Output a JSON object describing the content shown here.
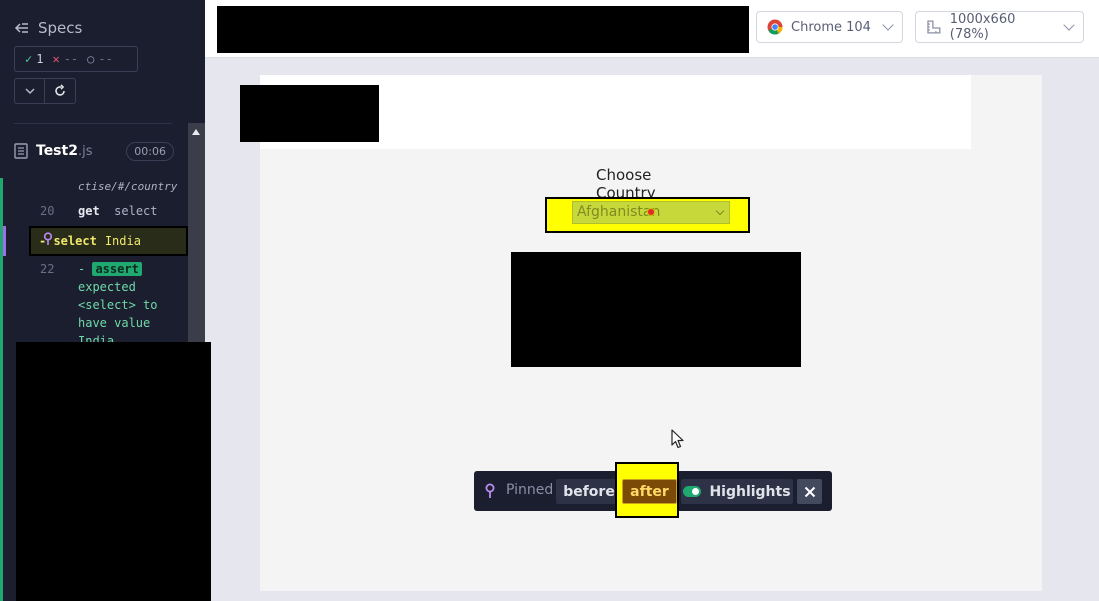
{
  "reporter": {
    "specs_label": "Specs",
    "stats": {
      "passed": "1",
      "failed": "--",
      "pending": "--"
    },
    "file": {
      "name": "Test2",
      "ext": ".js",
      "duration": "00:06"
    },
    "url_fragment": "ctise/#/country",
    "commands": [
      {
        "num": "20",
        "name": "get",
        "arg": "select"
      },
      {
        "num": "",
        "name": "select",
        "arg": "India"
      },
      {
        "num": "22",
        "name": "assert",
        "arg": "expected <select> to have value India"
      }
    ],
    "assert_lines": [
      "expected",
      "<select> to",
      "have value",
      "India"
    ]
  },
  "toolbar": {
    "browser": "Chrome 104",
    "viewport": "1000x660 (78%)"
  },
  "aut": {
    "choose_label": "Choose Country",
    "select_value": "Afghanistan"
  },
  "snapshot": {
    "pinned_label": "Pinned",
    "before_label": "before",
    "after_label": "after",
    "highlights_label": "Highlights"
  }
}
